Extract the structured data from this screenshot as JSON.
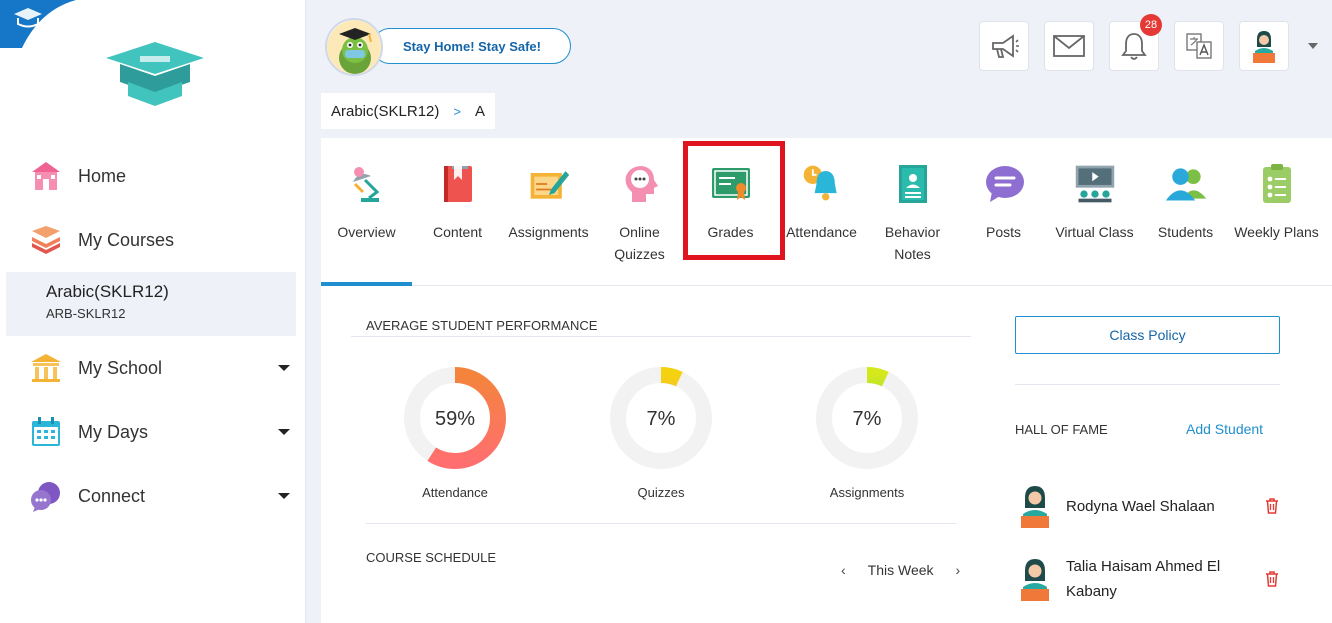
{
  "header": {
    "slogan": "Stay Home! Stay Safe!",
    "notification_count": "28"
  },
  "breadcrumb": {
    "course": "Arabic(SKLR12)",
    "separator": ">",
    "section": "A"
  },
  "sidebar": {
    "home": "Home",
    "my_courses": "My Courses",
    "current_course": {
      "name": "Arabic(SKLR12)",
      "code": "ARB-SKLR12"
    },
    "my_school": "My School",
    "my_days": "My Days",
    "connect": "Connect"
  },
  "tabs": [
    {
      "label": "Overview"
    },
    {
      "label": "Content"
    },
    {
      "label": "Assignments"
    },
    {
      "label": "Online Quizzes"
    },
    {
      "label": "Grades"
    },
    {
      "label": "Attendance"
    },
    {
      "label": "Behavior Notes"
    },
    {
      "label": "Posts"
    },
    {
      "label": "Virtual Class"
    },
    {
      "label": "Students"
    },
    {
      "label": "Weekly Plans"
    }
  ],
  "performance": {
    "title": "AVERAGE STUDENT PERFORMANCE",
    "items": [
      {
        "label": "Attendance",
        "value_text": "59%",
        "value": 59
      },
      {
        "label": "Quizzes",
        "value_text": "7%",
        "value": 7
      },
      {
        "label": "Assignments",
        "value_text": "7%",
        "value": 7
      }
    ]
  },
  "schedule": {
    "title": "COURSE SCHEDULE",
    "week_label": "This Week",
    "prev": "‹",
    "next": "›"
  },
  "right_panel": {
    "class_policy": "Class Policy",
    "hall_of_fame": "HALL OF FAME",
    "add_student": "Add Student",
    "students": [
      {
        "name": "Rodyna Wael Shalaan"
      },
      {
        "name": "Talia Haisam Ahmed El Kabany"
      }
    ]
  },
  "colors": {
    "accent": "#1f8fcf",
    "highlight": "#e0141e",
    "badge": "#e53935"
  }
}
